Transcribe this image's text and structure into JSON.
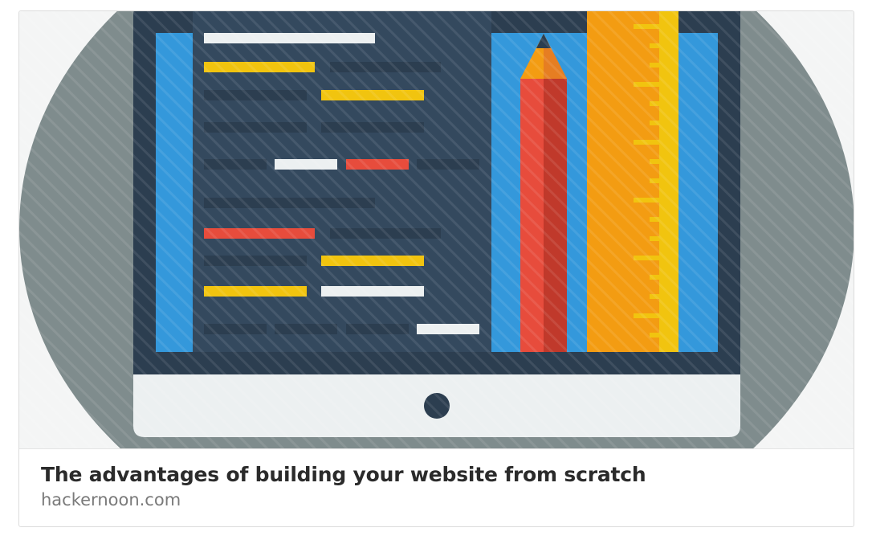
{
  "link_preview": {
    "title": "The advantages of building your website from scratch",
    "domain": "hackernoon.com",
    "image_icon": "monitor-code-pencil-ruler-illustration"
  },
  "colors": {
    "circle_bg": "#7f8c8d",
    "monitor_frame": "#2c3e50",
    "monitor_stand_panel": "#ecf0f1",
    "screen_blue": "#3498db",
    "code_panel": "#34495e",
    "code_line_dark": "#2c3e50",
    "code_line_yellow": "#f1c40f",
    "code_line_red": "#e74c3c",
    "code_line_white": "#ecf0f1",
    "pencil_red": "#e74c3c",
    "pencil_tip": "#f39c12",
    "ruler_orange": "#f39c12",
    "ruler_ticks": "#f1c40f",
    "title_text": "#2b2b2b",
    "domain_text": "#7a7a7a"
  }
}
